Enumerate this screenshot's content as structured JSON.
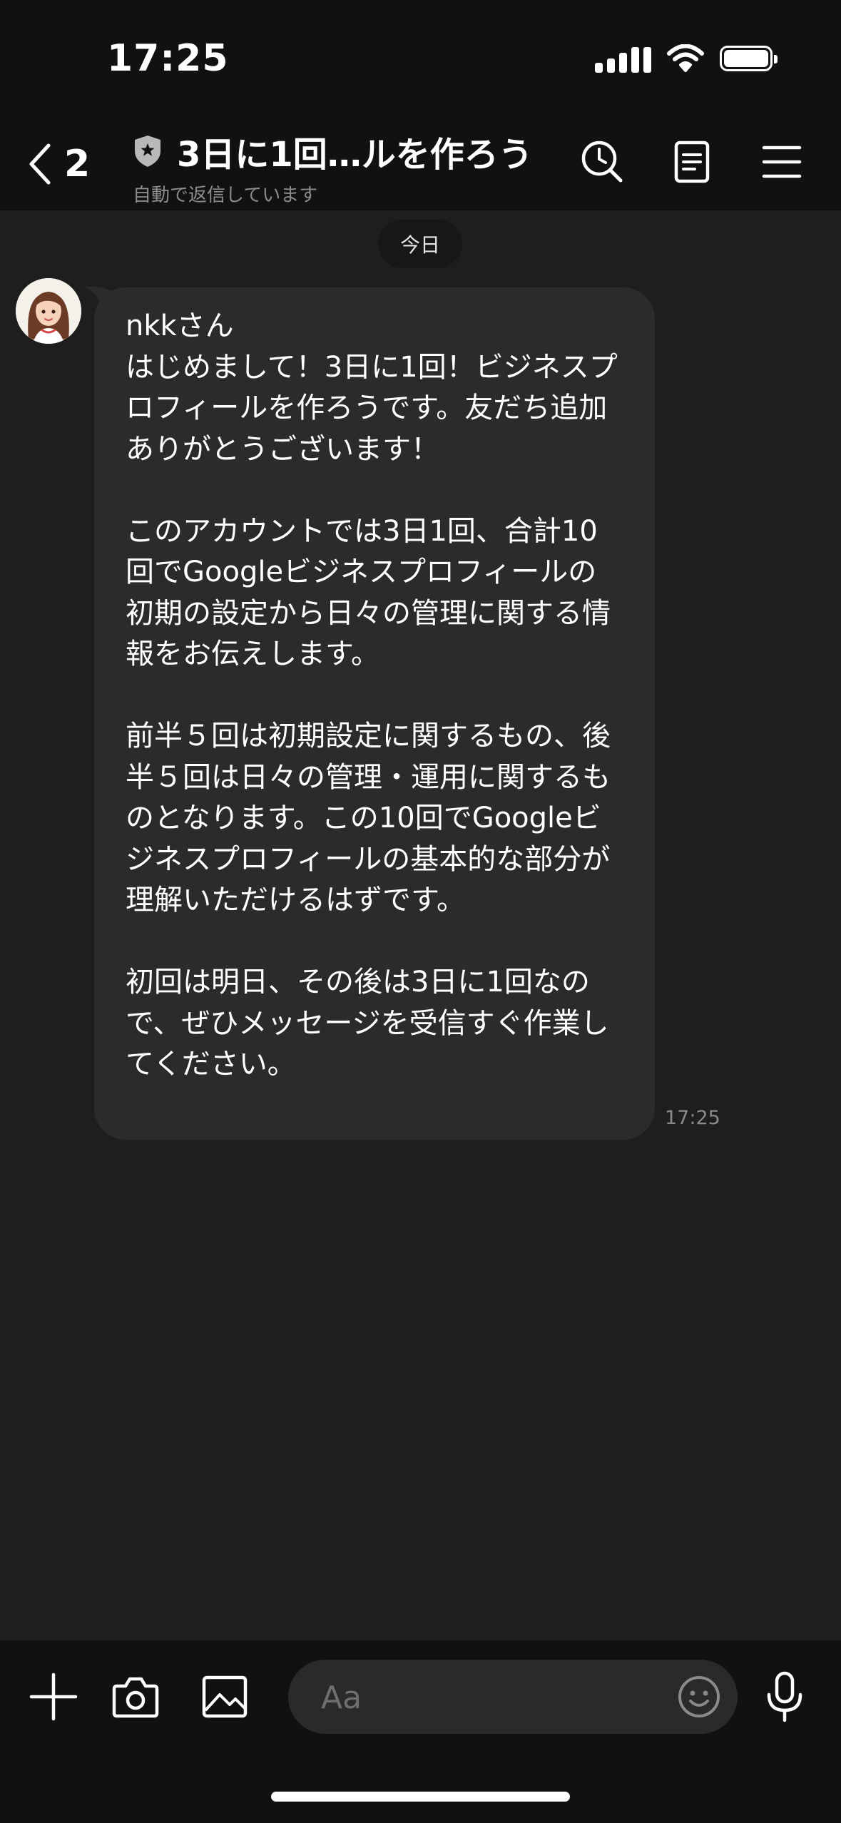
{
  "status_bar": {
    "time": "17:25"
  },
  "header": {
    "back_count": "2",
    "title": "3日に1回…ルを作ろう",
    "subtitle": "自動で返信しています"
  },
  "date_chip": "今日",
  "message": {
    "text": "nkkさん\nはじめまして！3日に1回！ビジネスプロフィールを作ろうです。友だち追加ありがとうございます！\n\nこのアカウントでは3日1回、合計10回でGoogleビジネスプロフィールの初期の設定から日々の管理に関する情報をお伝えします。\n\n前半５回は初期設定に関するもの、後半５回は日々の管理・運用に関するものとなります。この10回でGoogleビジネスプロフィールの基本的な部分が理解いただけるはずです。\n\n初回は明日、その後は3日に1回なので、ぜひメッセージを受信すぐ作業してください。",
    "time": "17:25"
  },
  "input": {
    "placeholder": "Aa"
  },
  "colors": {
    "background": "#1e1e1e",
    "bar": "#111111",
    "bubble": "#2b2b2b"
  },
  "icons": [
    "back-chevron-icon",
    "shield-icon",
    "search-icon",
    "notes-icon",
    "menu-icon",
    "plus-icon",
    "camera-icon",
    "image-icon",
    "emoji-icon",
    "microphone-icon"
  ]
}
